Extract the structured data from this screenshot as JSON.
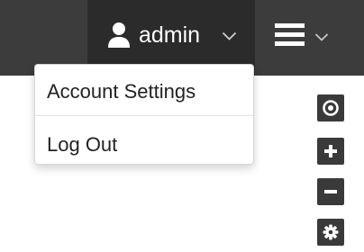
{
  "header": {
    "username": "admin",
    "user_icon": "user-icon",
    "user_chevron_icon": "chevron-down-icon",
    "main_menu_icon": "hamburger-menu-icon",
    "main_menu_chevron_icon": "chevron-down-icon"
  },
  "user_dropdown": {
    "items": [
      {
        "label": "Account Settings"
      },
      {
        "label": "Log Out"
      }
    ]
  },
  "map_controls": {
    "buttons": [
      {
        "icon": "locate-icon"
      },
      {
        "icon": "plus-icon"
      },
      {
        "icon": "minus-icon"
      },
      {
        "icon": "gear-icon"
      }
    ]
  },
  "colors": {
    "topbar": "#3c3c3c",
    "active_toggle": "#2b2b2b",
    "control_bg": "#3a3a3a",
    "icon": "#ffffff"
  }
}
